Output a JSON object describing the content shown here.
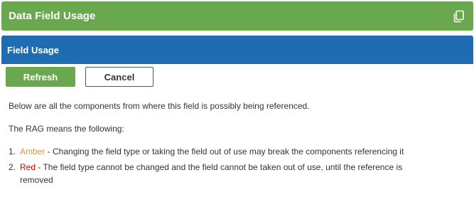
{
  "header": {
    "title": "Data Field Usage",
    "copy_icon": "copy-icon"
  },
  "section": {
    "title": "Field Usage"
  },
  "buttons": {
    "refresh_label": "Refresh",
    "cancel_label": "Cancel"
  },
  "content": {
    "intro": "Below are all the components from where this field is possibly being referenced.",
    "rag_intro": "The RAG means the following:",
    "items": [
      {
        "number": "1.",
        "status": "Amber",
        "status_color": "#e69138",
        "description": " - Changing the field type or taking the field out of use may break the components referencing it"
      },
      {
        "number": "2.",
        "status": "Red",
        "status_color": "#cc0000",
        "description": " - The field type cannot be changed and the field cannot be taken out of use, until the reference is removed"
      }
    ]
  },
  "colors": {
    "header_green": "#6aa84f",
    "section_blue": "#1f6db0"
  }
}
